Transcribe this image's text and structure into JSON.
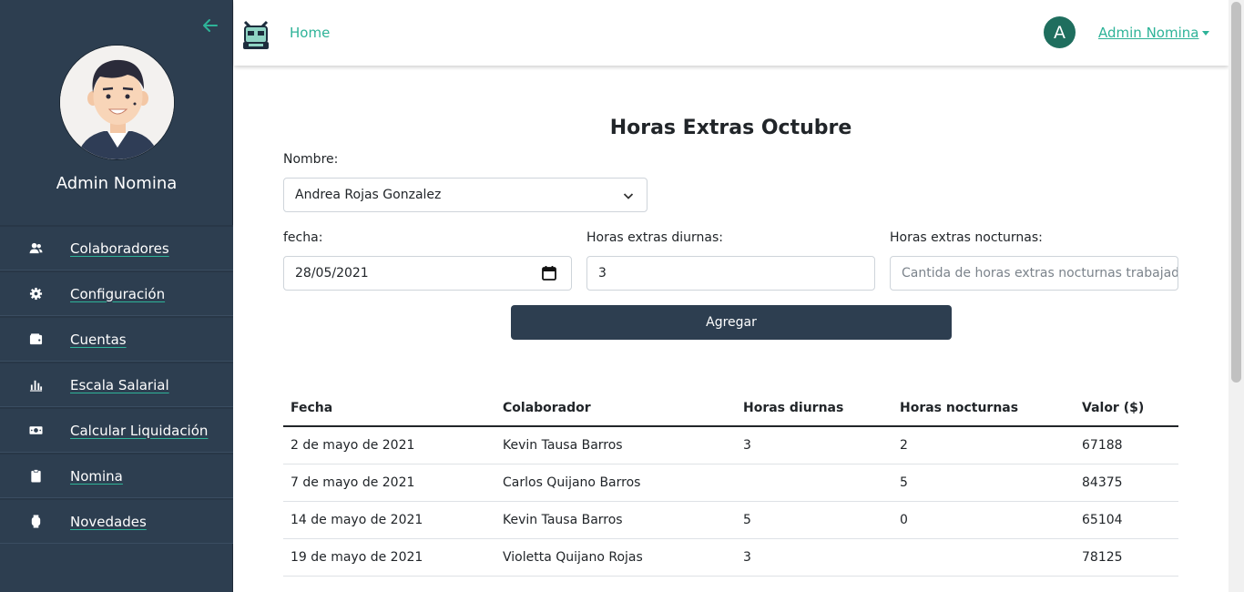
{
  "sidebar": {
    "user_name": "Admin Nomina",
    "items": [
      {
        "label": "Colaboradores",
        "icon": "users-icon"
      },
      {
        "label": "Configuración",
        "icon": "gear-icon"
      },
      {
        "label": "Cuentas",
        "icon": "wallet-icon"
      },
      {
        "label": "Escala Salarial",
        "icon": "bar-chart-icon"
      },
      {
        "label": "Calcular Liquidación",
        "icon": "money-bill-icon"
      },
      {
        "label": "Nomina",
        "icon": "clipboard-icon"
      },
      {
        "label": "Novedades",
        "icon": "watch-icon"
      }
    ]
  },
  "topbar": {
    "home_label": "Home",
    "avatar_initial": "A",
    "user_menu_label": "Admin Nomina"
  },
  "form": {
    "title": "Horas Extras Octubre",
    "nombre_label": "Nombre:",
    "nombre_value": "Andrea Rojas Gonzalez",
    "fecha_label": "fecha:",
    "fecha_value": "28/05/2021",
    "diurnas_label": "Horas extras diurnas:",
    "diurnas_value": "3",
    "nocturnas_label": "Horas extras nocturnas:",
    "nocturnas_placeholder": "Cantida de horas extras nocturnas trabajadas",
    "submit_label": "Agregar"
  },
  "table": {
    "headers": [
      "Fecha",
      "Colaborador",
      "Horas diurnas",
      "Horas nocturnas",
      "Valor ($)"
    ],
    "rows": [
      [
        "2 de mayo de 2021",
        "Kevin Tausa Barros",
        "3",
        "2",
        "67188"
      ],
      [
        "7 de mayo de 2021",
        "Carlos Quijano Barros",
        "",
        "5",
        "84375"
      ],
      [
        "14 de mayo de 2021",
        "Kevin Tausa Barros",
        "5",
        "0",
        "65104"
      ],
      [
        "19 de mayo de 2021",
        "Violetta Quijano Rojas",
        "3",
        "",
        "78125"
      ]
    ]
  },
  "colors": {
    "sidebar_bg": "#2d3e50",
    "accent": "#2eb398",
    "avatar_bg": "#1f6e5e"
  }
}
